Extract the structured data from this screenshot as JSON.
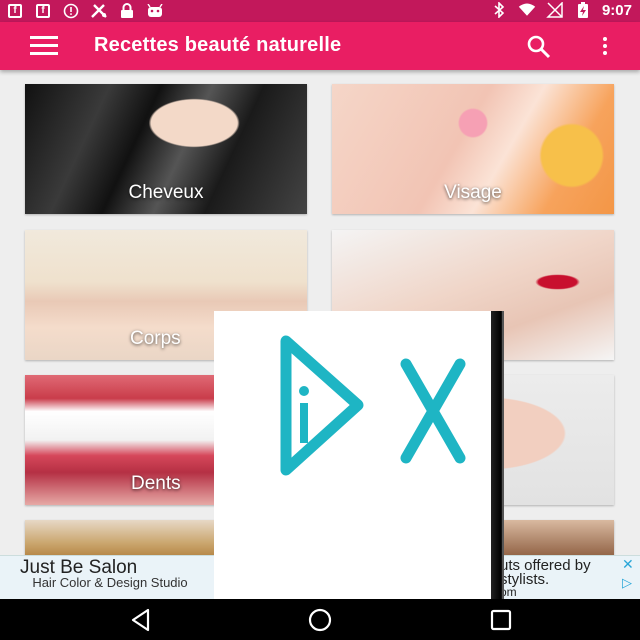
{
  "status_bar": {
    "time": "9:07",
    "left_icons": [
      "facebook-icon",
      "facebook-icon",
      "alert-icon",
      "game-icon",
      "lock-icon",
      "android-icon"
    ],
    "right_icons": [
      "bluetooth-icon",
      "wifi-icon",
      "signal-icon",
      "battery-charging-icon"
    ]
  },
  "app_bar": {
    "title": "Recettes beauté naturelle",
    "background": "#e91e63",
    "status_background": "#c2185b",
    "icons": [
      "menu-icon",
      "search-icon",
      "more-vert-icon"
    ]
  },
  "categories": [
    {
      "label": "Cheveux"
    },
    {
      "label": "Visage"
    },
    {
      "label": "Corps"
    },
    {
      "label": "s"
    },
    {
      "label": "Dents"
    },
    {
      "label": "s"
    }
  ],
  "ad_banner": {
    "headline": "Just Be Salon",
    "subline": "Hair Color & Design Studio",
    "right_line1": "uts offered by",
    "right_line2": "stylists.",
    "right_line3": "om",
    "icons": [
      "close-icon",
      "adchoices-icon"
    ]
  },
  "overlay_ad": {
    "icons": [
      "play-icon",
      "close-icon"
    ],
    "accent": "#1eb5c4"
  },
  "nav_bar": {
    "icons": [
      "back-icon",
      "home-icon",
      "recents-icon"
    ]
  }
}
